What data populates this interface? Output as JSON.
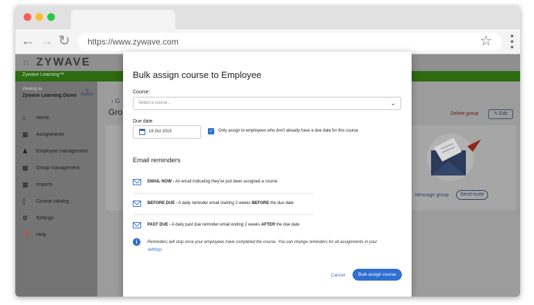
{
  "browser": {
    "url": "https://www.zywave.com"
  },
  "app": {
    "logo": "ZYWAVE",
    "product": "Zywave Learning™",
    "viewing_as": "Viewing as",
    "org": "Zywave Learning Demo",
    "switch_label": "Switch",
    "sidebar": [
      {
        "label": "Home",
        "icon": "home-icon"
      },
      {
        "label": "Assignments",
        "icon": "calendar-icon"
      },
      {
        "label": "Employee management",
        "icon": "person-icon"
      },
      {
        "label": "Group management",
        "icon": "group-icon"
      },
      {
        "label": "Imports",
        "icon": "grid-icon"
      },
      {
        "label": "Course catalog",
        "icon": "book-icon"
      },
      {
        "label": "Settings",
        "icon": "gear-icon"
      },
      {
        "label": "Help",
        "icon": "help-icon"
      }
    ],
    "back_label": "G",
    "page_title_fragment": "Gro",
    "delete_group": "Delete group",
    "edit": "Edit",
    "message_group": "Message group",
    "send_invite": "Send invite"
  },
  "modal": {
    "title": "Bulk assign course to Employee",
    "course_label": "Course:",
    "course_placeholder": "Select a course...",
    "due_date_label": "Due date",
    "due_date_value": "18 Oct 2019",
    "checkbox_checked": true,
    "checkbox_label": "Only assign to employees who don't already have a due date for this course",
    "reminders_title": "Email reminders",
    "reminders": [
      {
        "bold": "EMAIL NOW -",
        "text": " An email indicating they've just been assigned a course",
        "bold2": "",
        "tail": ""
      },
      {
        "bold": "BEFORE DUE -",
        "text": " A daily reminder email starting 2 weeks ",
        "bold2": "BEFORE",
        "tail": " the due date"
      },
      {
        "bold": "PAST DUE -",
        "text": " A daily past due reminder email ending 2 weeks ",
        "bold2": "AFTER",
        "tail": " the due date"
      }
    ],
    "info_text": "Reminders will stop once your employees have completed the course. You can change reminders for all assignments in your",
    "info_link": "settings.",
    "cancel": "Cancel",
    "primary": "Bulk assign course"
  },
  "colors": {
    "accent": "#2e6fd0",
    "green_bar": "#2e6a10"
  }
}
